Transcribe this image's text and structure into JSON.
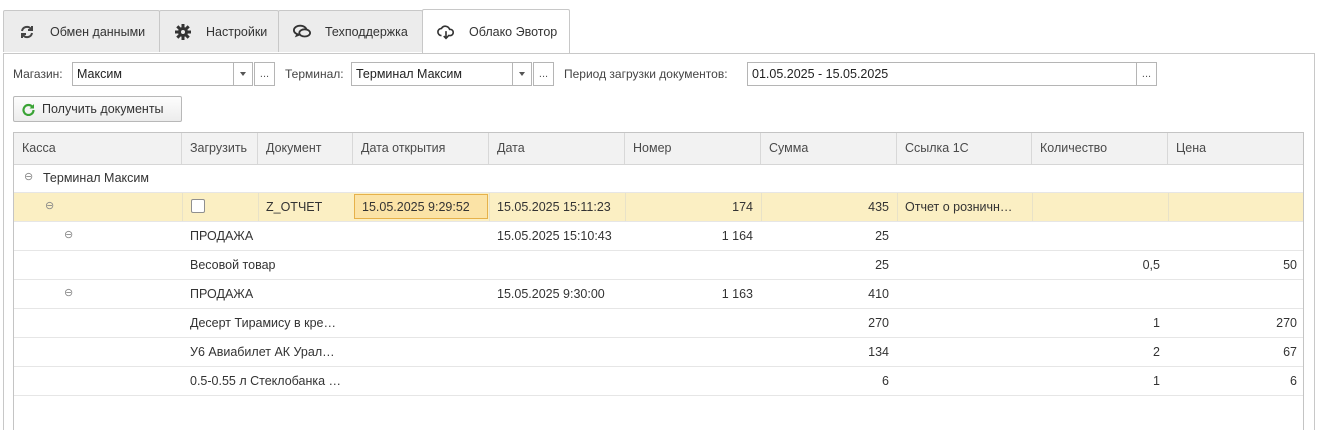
{
  "tabs": [
    {
      "label": "Обмен данными",
      "icon": "sync-icon"
    },
    {
      "label": "Настройки",
      "icon": "gear-icon"
    },
    {
      "label": "Техподдержка",
      "icon": "chat-icon"
    },
    {
      "label": "Облако Эвотор",
      "icon": "cloud-icon",
      "active": true
    }
  ],
  "filters": {
    "store_label": "Магазин:",
    "store_value": "Максим",
    "terminal_label": "Терминал:",
    "terminal_value": "Терминал Максим",
    "period_label": "Период загрузки документов:",
    "period_value": "01.05.2025 - 15.05.2025",
    "dots": "..."
  },
  "get_docs_button": "Получить документы",
  "table": {
    "columns": [
      "Касса",
      "Загрузить",
      "Документ",
      "Дата открытия",
      "Дата",
      "Номер",
      "Сумма",
      "Ссылка 1С",
      "Количество",
      "Цена"
    ],
    "group": {
      "toggle": "⊖",
      "label": "Терминал Максим"
    },
    "rows": [
      {
        "toggle": "⊖",
        "doc": "Z_ОТЧЕТ",
        "opened": "15.05.2025 9:29:52",
        "date": "15.05.2025 15:11:23",
        "number": "174",
        "sum": "435",
        "link": "Отчет о розничн…",
        "qty": "",
        "price": "",
        "checked": false
      },
      {
        "toggle": "⊖",
        "doc": "ПРОДАЖА",
        "date": "15.05.2025 15:10:43",
        "number": "1 164",
        "sum": "25",
        "qty": "",
        "price": ""
      },
      {
        "item": "Весовой товар",
        "sum": "25",
        "qty": "0,5",
        "price": "50"
      },
      {
        "toggle": "⊖",
        "doc": "ПРОДАЖА",
        "date": "15.05.2025 9:30:00",
        "number": "1 163",
        "sum": "410",
        "qty": "",
        "price": ""
      },
      {
        "item": "Десерт Тирамису в кре…",
        "sum": "270",
        "qty": "1",
        "price": "270"
      },
      {
        "item": "У6 Авиабилет АК Урал…",
        "sum": "134",
        "qty": "2",
        "price": "67"
      },
      {
        "item": "0.5-0.55 л Стеклобанка …",
        "sum": "6",
        "qty": "1",
        "price": "6"
      }
    ]
  },
  "colors": {
    "accent_green": "#3aa335",
    "selected_row": "#fbefc3",
    "focus_border": "#e6b14a"
  }
}
